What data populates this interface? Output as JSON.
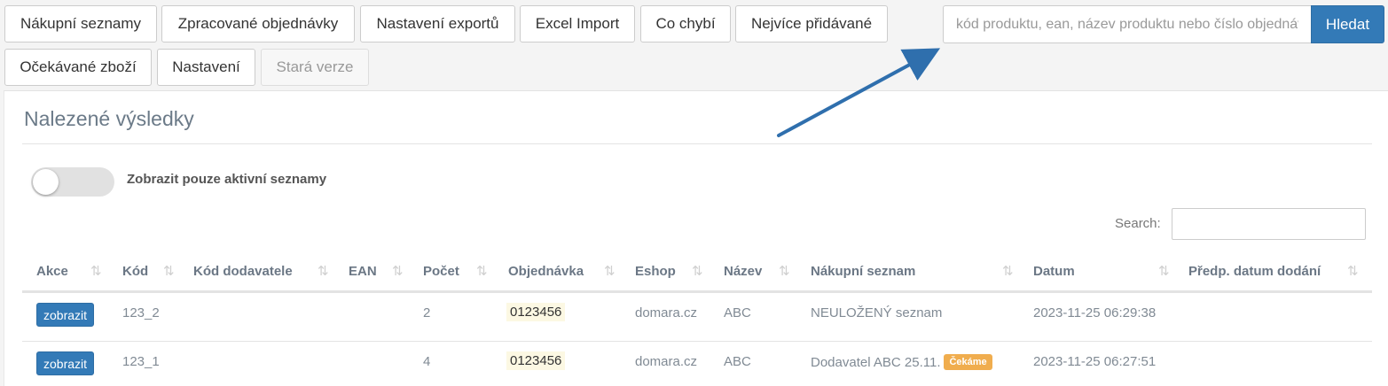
{
  "toolbar": {
    "buttons": [
      "Nákupní seznamy",
      "Zpracované objednávky",
      "Nastavení exportů",
      "Excel Import",
      "Co chybí",
      "Nejvíce přidávané",
      "Očekávané zboží",
      "Nastavení",
      "Stará verze"
    ]
  },
  "search": {
    "placeholder": "kód produktu, ean, název produktu nebo číslo objednávky",
    "button_label": "Hledat"
  },
  "panel": {
    "title": "Nalezené výsledky",
    "toggle_label": "Zobrazit pouze aktivní seznamy",
    "toggle_on": false,
    "table_search_label": "Search:"
  },
  "table": {
    "columns": [
      "Akce",
      "Kód",
      "Kód dodavatele",
      "EAN",
      "Počet",
      "Objednávka",
      "Eshop",
      "Název",
      "Nákupní seznam",
      "Datum",
      "Předp. datum dodání"
    ],
    "sort_icon": "⇅",
    "rows": [
      {
        "action": "zobrazit",
        "code": "123_2",
        "supplier_code": "",
        "ean": "",
        "count": "2",
        "order": "0123456",
        "eshop": "domara.cz",
        "name": "ABC",
        "list": "NEULOŽENÝ seznam",
        "badge": "",
        "date": "2023-11-25 06:29:38",
        "expected_date": ""
      },
      {
        "action": "zobrazit",
        "code": "123_1",
        "supplier_code": "",
        "ean": "",
        "count": "4",
        "order": "0123456",
        "eshop": "domara.cz",
        "name": "ABC",
        "list": "Dodavatel ABC 25.11.",
        "badge": "Čekáme",
        "date": "2023-11-25 06:27:51",
        "expected_date": ""
      }
    ]
  },
  "colors": {
    "primary": "#337ab7",
    "badge_warning": "#f0ad4e",
    "order_highlight": "#fcf8e3",
    "annotation_arrow": "#2f6fad"
  }
}
